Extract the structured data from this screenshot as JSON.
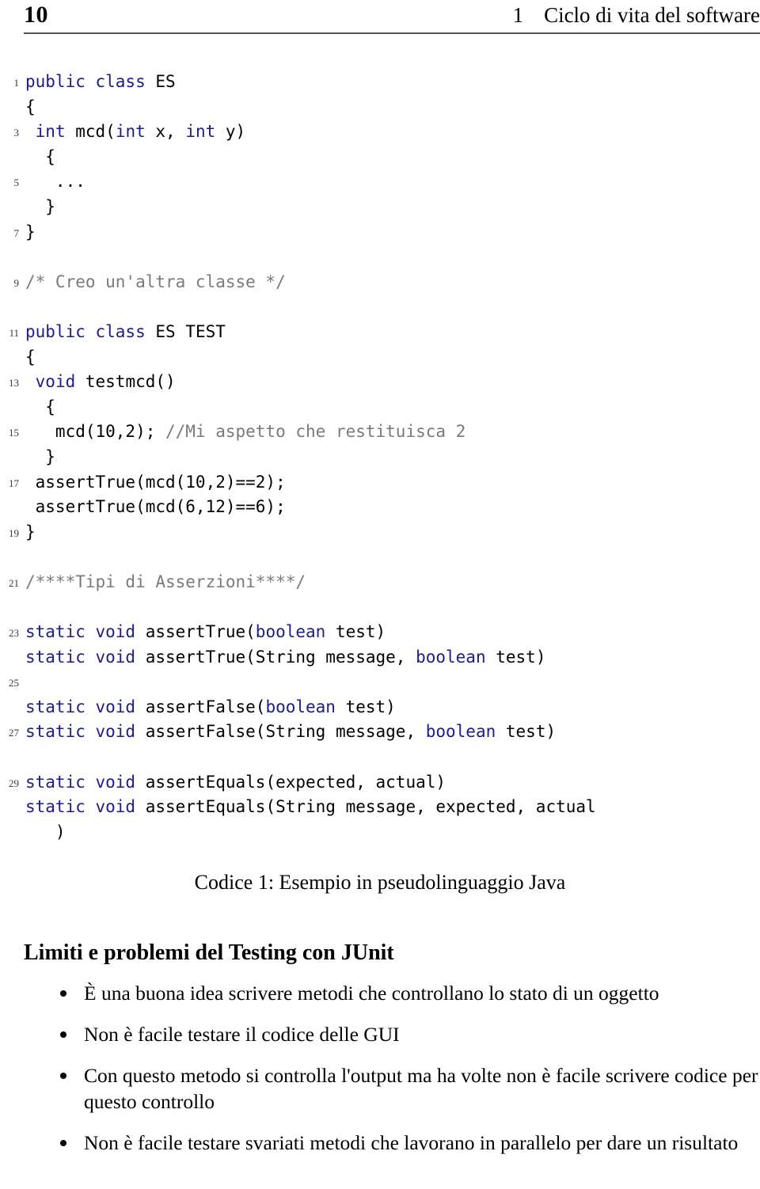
{
  "header": {
    "folio": "10",
    "chapter_number": "1",
    "chapter_title": "Ciclo di vita del software"
  },
  "listing": {
    "caption": "Codice 1: Esempio in pseudolinguaggio Java",
    "colors": {
      "keyword": "#1c1c8c",
      "comment": "#7a7a7a",
      "plain": "#000000"
    },
    "lines": [
      {
        "no": "1",
        "tokens": [
          {
            "t": "public class ",
            "c": "kw"
          },
          {
            "t": "ES",
            "c": "pln"
          }
        ]
      },
      {
        "no": "",
        "tokens": [
          {
            "t": "{",
            "c": "pln"
          }
        ]
      },
      {
        "no": "3",
        "tokens": [
          {
            "t": " ",
            "c": "pln"
          },
          {
            "t": "int",
            "c": "kw"
          },
          {
            "t": " mcd(",
            "c": "pln"
          },
          {
            "t": "int",
            "c": "kw"
          },
          {
            "t": " x, ",
            "c": "pln"
          },
          {
            "t": "int",
            "c": "kw"
          },
          {
            "t": " y)",
            "c": "pln"
          }
        ]
      },
      {
        "no": "",
        "tokens": [
          {
            "t": "  {",
            "c": "pln"
          }
        ]
      },
      {
        "no": "5",
        "tokens": [
          {
            "t": "   ...",
            "c": "pln"
          }
        ]
      },
      {
        "no": "",
        "tokens": [
          {
            "t": "  }",
            "c": "pln"
          }
        ]
      },
      {
        "no": "7",
        "tokens": [
          {
            "t": "}",
            "c": "pln"
          }
        ]
      },
      {
        "no": "",
        "tokens": []
      },
      {
        "no": "9",
        "tokens": [
          {
            "t": "/* Creo un'altra classe */",
            "c": "cmt"
          }
        ]
      },
      {
        "no": "",
        "tokens": []
      },
      {
        "no": "11",
        "tokens": [
          {
            "t": "public class ",
            "c": "kw"
          },
          {
            "t": "ES TEST",
            "c": "pln"
          }
        ]
      },
      {
        "no": "",
        "tokens": [
          {
            "t": "{",
            "c": "pln"
          }
        ]
      },
      {
        "no": "13",
        "tokens": [
          {
            "t": " ",
            "c": "pln"
          },
          {
            "t": "void",
            "c": "kw"
          },
          {
            "t": " testmcd()",
            "c": "pln"
          }
        ]
      },
      {
        "no": "",
        "tokens": [
          {
            "t": "  {",
            "c": "pln"
          }
        ]
      },
      {
        "no": "15",
        "tokens": [
          {
            "t": "   mcd(10,2); ",
            "c": "pln"
          },
          {
            "t": "//Mi aspetto che restituisca 2",
            "c": "cmt"
          }
        ]
      },
      {
        "no": "",
        "tokens": [
          {
            "t": "  }",
            "c": "pln"
          }
        ]
      },
      {
        "no": "17",
        "tokens": [
          {
            "t": " assertTrue(mcd(10,2)==2);",
            "c": "pln"
          }
        ]
      },
      {
        "no": "",
        "tokens": [
          {
            "t": " assertTrue(mcd(6,12)==6);",
            "c": "pln"
          }
        ]
      },
      {
        "no": "19",
        "tokens": [
          {
            "t": "}",
            "c": "pln"
          }
        ]
      },
      {
        "no": "",
        "tokens": []
      },
      {
        "no": "21",
        "tokens": [
          {
            "t": "/****Tipi di Asserzioni****/",
            "c": "cmt"
          }
        ]
      },
      {
        "no": "",
        "tokens": []
      },
      {
        "no": "23",
        "tokens": [
          {
            "t": "static void",
            "c": "kw"
          },
          {
            "t": " assertTrue(",
            "c": "pln"
          },
          {
            "t": "boolean",
            "c": "kw"
          },
          {
            "t": " test)",
            "c": "pln"
          }
        ]
      },
      {
        "no": "",
        "tokens": [
          {
            "t": "static void",
            "c": "kw"
          },
          {
            "t": " assertTrue(String message, ",
            "c": "pln"
          },
          {
            "t": "boolean",
            "c": "kw"
          },
          {
            "t": " test)",
            "c": "pln"
          }
        ]
      },
      {
        "no": "25",
        "tokens": []
      },
      {
        "no": "",
        "tokens": [
          {
            "t": "static void",
            "c": "kw"
          },
          {
            "t": " assertFalse(",
            "c": "pln"
          },
          {
            "t": "boolean",
            "c": "kw"
          },
          {
            "t": " test)",
            "c": "pln"
          }
        ]
      },
      {
        "no": "27",
        "tokens": [
          {
            "t": "static void",
            "c": "kw"
          },
          {
            "t": " assertFalse(String message, ",
            "c": "pln"
          },
          {
            "t": "boolean",
            "c": "kw"
          },
          {
            "t": " test)",
            "c": "pln"
          }
        ]
      },
      {
        "no": "",
        "tokens": []
      },
      {
        "no": "29",
        "tokens": [
          {
            "t": "static void",
            "c": "kw"
          },
          {
            "t": " assertEquals(expected, actual)",
            "c": "pln"
          }
        ]
      },
      {
        "no": "",
        "tokens": [
          {
            "t": "static void",
            "c": "kw"
          },
          {
            "t": " assertEquals(String message, expected, actual",
            "c": "pln"
          }
        ]
      },
      {
        "no": "",
        "tokens": [
          {
            "t": "   )",
            "c": "pln"
          }
        ]
      }
    ]
  },
  "section": {
    "heading": "Limiti e problemi del Testing con JUnit",
    "bullets": [
      "È una buona idea scrivere metodi che controllano lo stato di un oggetto",
      "Non è facile testare il codice delle GUI",
      "Con questo metodo si controlla l'output ma ha volte non è facile scrivere codice per questo controllo",
      "Non è facile testare svariati metodi che lavorano in parallelo per dare un risultato"
    ]
  }
}
